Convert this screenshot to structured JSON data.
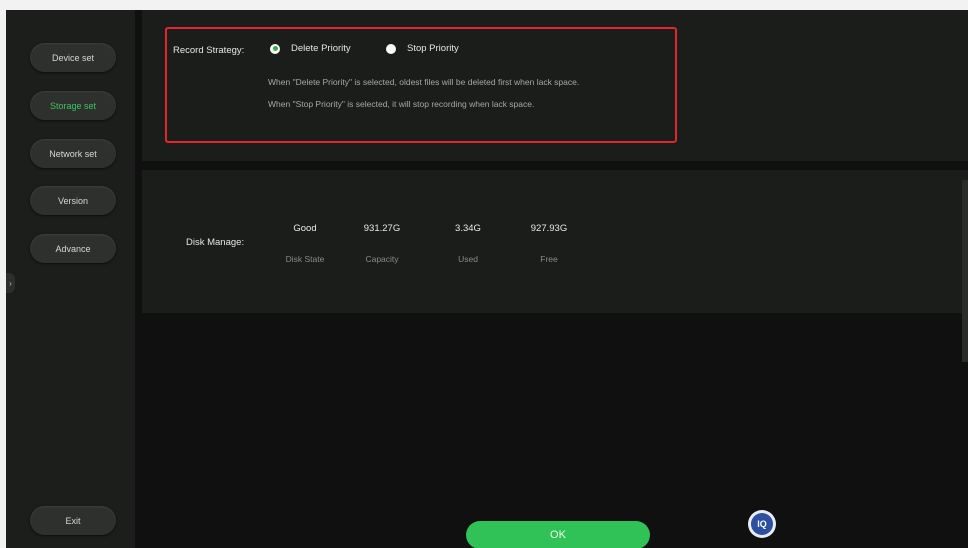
{
  "sidebar": {
    "items": [
      {
        "label": "Device set",
        "active": false
      },
      {
        "label": "Storage set",
        "active": true
      },
      {
        "label": "Network set",
        "active": false
      },
      {
        "label": "Version",
        "active": false
      },
      {
        "label": "Advance",
        "active": false
      }
    ],
    "exit_label": "Exit",
    "collapse_glyph": "›"
  },
  "record_strategy": {
    "label": "Record Strategy:",
    "options": [
      {
        "label": "Delete Priority",
        "selected": true
      },
      {
        "label": "Stop Priority",
        "selected": false
      }
    ],
    "hints": [
      "When \"Delete Priority\" is selected, oldest files will be deleted first when lack space.",
      "When \"Stop Priority\" is selected, it will stop recording when lack space."
    ]
  },
  "disk": {
    "label": "Disk Manage:",
    "columns": [
      {
        "value": "Good",
        "caption": "Disk State"
      },
      {
        "value": "931.27G",
        "caption": "Capacity"
      },
      {
        "value": "3.34G",
        "caption": "Used"
      },
      {
        "value": "927.93G",
        "caption": "Free"
      }
    ]
  },
  "footer": {
    "ok_label": "OK",
    "logo_text": "IQ"
  },
  "colors": {
    "accent_green": "#31c257",
    "highlight_red": "#e3262b",
    "background": "#101010",
    "panel": "#1a1d1a"
  }
}
